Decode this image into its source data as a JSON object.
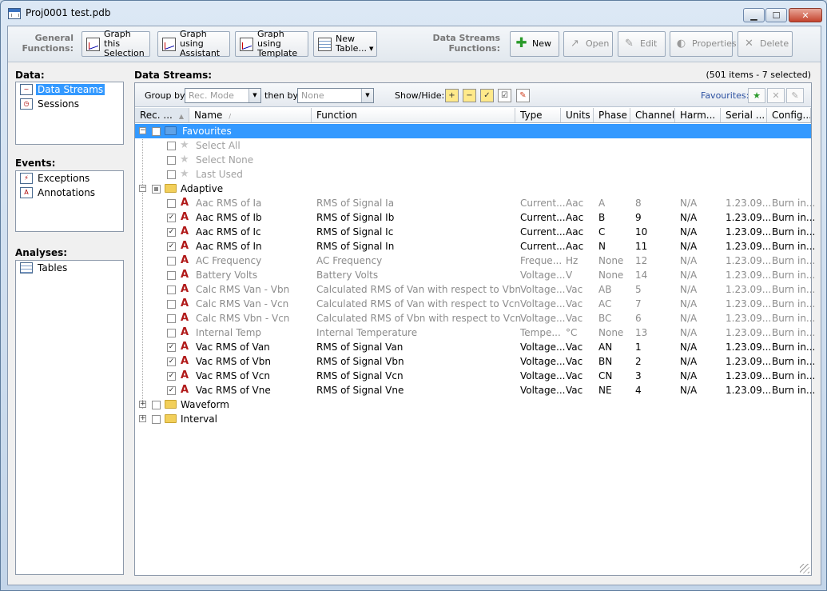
{
  "window": {
    "title": "Proj0001 test.pdb",
    "min_glyph": "▁",
    "max_glyph": "☐",
    "close_glyph": "✕"
  },
  "toolbar": {
    "general_label": "General Functions:",
    "buttons": {
      "graph_selection": "Graph this Selection",
      "graph_assistant": "Graph using Assistant",
      "graph_template": "Graph using Template",
      "new_table": "New Table..."
    },
    "ds_label": "Data Streams Functions:",
    "ds_buttons": {
      "new": "New",
      "open": "Open",
      "edit": "Edit",
      "properties": "Properties",
      "delete": "Delete"
    }
  },
  "sidebar": {
    "data_label": "Data:",
    "data_items": [
      "Data Streams",
      "Sessions"
    ],
    "events_label": "Events:",
    "events_items": [
      "Exceptions",
      "Annotations"
    ],
    "analyses_label": "Analyses:",
    "analyses_items": [
      "Tables"
    ]
  },
  "main": {
    "title": "Data Streams:",
    "count": "(501 items - 7 selected)",
    "group_by_label": "Group by",
    "group_by_value": "Rec. Mode",
    "then_by_label": "then by",
    "then_by_value": "None",
    "show_hide_label": "Show/Hide:",
    "favourites_label": "Favourites:",
    "columns": [
      "Rec. ...",
      "Name",
      "Function",
      "Type",
      "Units",
      "Phase",
      "Channel",
      "Harm...",
      "Serial ...",
      "Config..."
    ],
    "tree": {
      "favourites": {
        "label": "Favourites",
        "items": [
          "Select All",
          "Select None",
          "Last Used"
        ]
      },
      "adaptive": {
        "label": "Adaptive"
      },
      "waveform": {
        "label": "Waveform"
      },
      "interval": {
        "label": "Interval"
      }
    },
    "rows": [
      {
        "checked": false,
        "name": "Aac RMS of Ia",
        "function": "RMS of Signal Ia",
        "type": "Current...",
        "units": "Aac",
        "phase": "A",
        "channel": "8",
        "harm": "N/A",
        "serial": "1.23.09...",
        "config": "Burn in..."
      },
      {
        "checked": true,
        "name": "Aac RMS of Ib",
        "function": "RMS of Signal Ib",
        "type": "Current...",
        "units": "Aac",
        "phase": "B",
        "channel": "9",
        "harm": "N/A",
        "serial": "1.23.09...",
        "config": "Burn in..."
      },
      {
        "checked": true,
        "name": "Aac RMS of Ic",
        "function": "RMS of Signal Ic",
        "type": "Current...",
        "units": "Aac",
        "phase": "C",
        "channel": "10",
        "harm": "N/A",
        "serial": "1.23.09...",
        "config": "Burn in..."
      },
      {
        "checked": true,
        "name": "Aac RMS of In",
        "function": "RMS of Signal In",
        "type": "Current...",
        "units": "Aac",
        "phase": "N",
        "channel": "11",
        "harm": "N/A",
        "serial": "1.23.09...",
        "config": "Burn in..."
      },
      {
        "checked": false,
        "name": "AC Frequency",
        "function": "AC Frequency",
        "type": "Freque...",
        "units": "Hz",
        "phase": "None",
        "channel": "12",
        "harm": "N/A",
        "serial": "1.23.09...",
        "config": "Burn in..."
      },
      {
        "checked": false,
        "name": "Battery Volts",
        "function": "Battery Volts",
        "type": "Voltage...",
        "units": "V",
        "phase": "None",
        "channel": "14",
        "harm": "N/A",
        "serial": "1.23.09...",
        "config": "Burn in..."
      },
      {
        "checked": false,
        "name": "Calc RMS Van - Vbn",
        "function": "Calculated RMS of Van with respect to Vbn",
        "type": "Voltage...",
        "units": "Vac",
        "phase": "AB",
        "channel": "5",
        "harm": "N/A",
        "serial": "1.23.09...",
        "config": "Burn in..."
      },
      {
        "checked": false,
        "name": "Calc RMS Van - Vcn",
        "function": "Calculated RMS of Van with respect to Vcn",
        "type": "Voltage...",
        "units": "Vac",
        "phase": "AC",
        "channel": "7",
        "harm": "N/A",
        "serial": "1.23.09...",
        "config": "Burn in..."
      },
      {
        "checked": false,
        "name": "Calc RMS Vbn - Vcn",
        "function": "Calculated RMS of Vbn with respect to Vcn",
        "type": "Voltage...",
        "units": "Vac",
        "phase": "BC",
        "channel": "6",
        "harm": "N/A",
        "serial": "1.23.09...",
        "config": "Burn in..."
      },
      {
        "checked": false,
        "name": "Internal Temp",
        "function": "Internal Temperature",
        "type": "Tempe...",
        "units": "°C",
        "phase": "None",
        "channel": "13",
        "harm": "N/A",
        "serial": "1.23.09...",
        "config": "Burn in..."
      },
      {
        "checked": true,
        "name": "Vac RMS of Van",
        "function": "RMS of Signal Van",
        "type": "Voltage...",
        "units": "Vac",
        "phase": "AN",
        "channel": "1",
        "harm": "N/A",
        "serial": "1.23.09...",
        "config": "Burn in..."
      },
      {
        "checked": true,
        "name": "Vac RMS of Vbn",
        "function": "RMS of Signal Vbn",
        "type": "Voltage...",
        "units": "Vac",
        "phase": "BN",
        "channel": "2",
        "harm": "N/A",
        "serial": "1.23.09...",
        "config": "Burn in..."
      },
      {
        "checked": true,
        "name": "Vac RMS of Vcn",
        "function": "RMS of Signal Vcn",
        "type": "Voltage...",
        "units": "Vac",
        "phase": "CN",
        "channel": "3",
        "harm": "N/A",
        "serial": "1.23.09...",
        "config": "Burn in..."
      },
      {
        "checked": true,
        "name": "Vac RMS of Vne",
        "function": "RMS of Signal Vne",
        "type": "Voltage...",
        "units": "Vac",
        "phase": "NE",
        "channel": "4",
        "harm": "N/A",
        "serial": "1.23.09...",
        "config": "Burn in..."
      }
    ]
  },
  "colors": {
    "selection": "#3399ff",
    "title_bar": "#dce8f5",
    "signal_icon": "#b01818"
  }
}
